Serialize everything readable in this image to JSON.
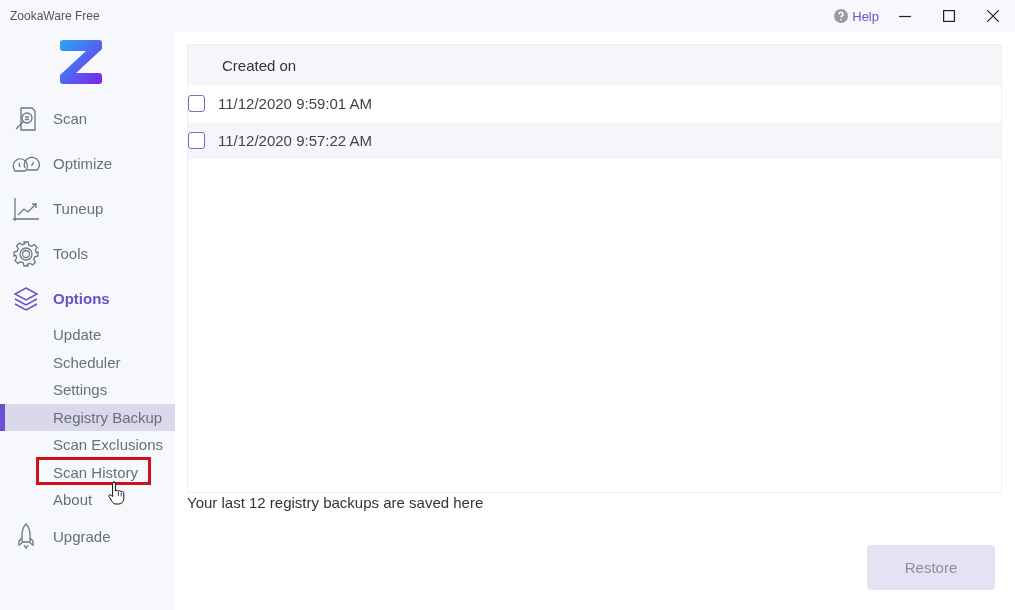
{
  "window": {
    "title": "ZookaWare Free",
    "help": "Help"
  },
  "sidebar": {
    "items": [
      {
        "label": "Scan",
        "selected": false
      },
      {
        "label": "Optimize",
        "selected": false
      },
      {
        "label": "Tuneup",
        "selected": false
      },
      {
        "label": "Tools",
        "selected": false
      },
      {
        "label": "Options",
        "selected": true,
        "children": [
          {
            "label": "Update",
            "selected": false,
            "highlighted": false
          },
          {
            "label": "Scheduler",
            "selected": false,
            "highlighted": false
          },
          {
            "label": "Settings",
            "selected": false,
            "highlighted": false
          },
          {
            "label": "Registry Backup",
            "selected": true,
            "highlighted": false
          },
          {
            "label": "Scan Exclusions",
            "selected": false,
            "highlighted": false
          },
          {
            "label": "Scan History",
            "selected": false,
            "highlighted": true
          },
          {
            "label": "About",
            "selected": false,
            "highlighted": false
          }
        ]
      },
      {
        "label": "Upgrade",
        "selected": false
      }
    ]
  },
  "table": {
    "columns": [
      "Created on"
    ],
    "rows": [
      {
        "created_on": "11/12/2020 9:59:01 AM",
        "checked": false
      },
      {
        "created_on": "11/12/2020 9:57:22 AM",
        "checked": false
      }
    ]
  },
  "caption": "Your last 12 registry backups are saved here",
  "restore_button": {
    "label": "Restore",
    "disabled": true
  }
}
